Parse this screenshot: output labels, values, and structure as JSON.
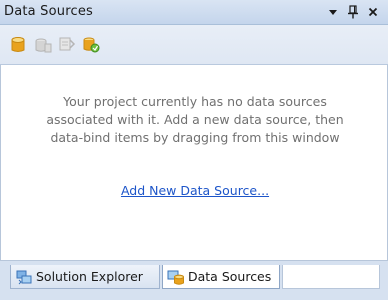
{
  "window": {
    "title": "Data Sources",
    "controls": [
      {
        "name": "dropdown-arrow-icon",
        "glyph": "▾"
      },
      {
        "name": "pin-icon",
        "glyph": "📌"
      },
      {
        "name": "close-icon",
        "glyph": "×"
      }
    ]
  },
  "toolbar": {
    "buttons": [
      {
        "name": "add-new-data-source-icon",
        "enabled": true
      },
      {
        "name": "edit-dataset-with-designer-icon",
        "enabled": false
      },
      {
        "name": "configure-dataset-with-wizard-icon",
        "enabled": false
      },
      {
        "name": "refresh-icon",
        "enabled": true
      }
    ]
  },
  "main": {
    "message_lines": [
      "Your project currently has no data sources",
      "associated with it. Add a new data source, then",
      "data-bind items by dragging from this window"
    ],
    "link_label": "Add New Data Source..."
  },
  "tabs": [
    {
      "label": "Solution Explorer",
      "icon": "solution-explorer-icon",
      "active": false
    },
    {
      "label": "Data Sources",
      "icon": "data-sources-icon",
      "active": true
    }
  ],
  "colors": {
    "title_bar": "#c4d5ec",
    "link": "#1d55c9",
    "message_text": "#707070",
    "icon_gold": "#e9a21d"
  }
}
